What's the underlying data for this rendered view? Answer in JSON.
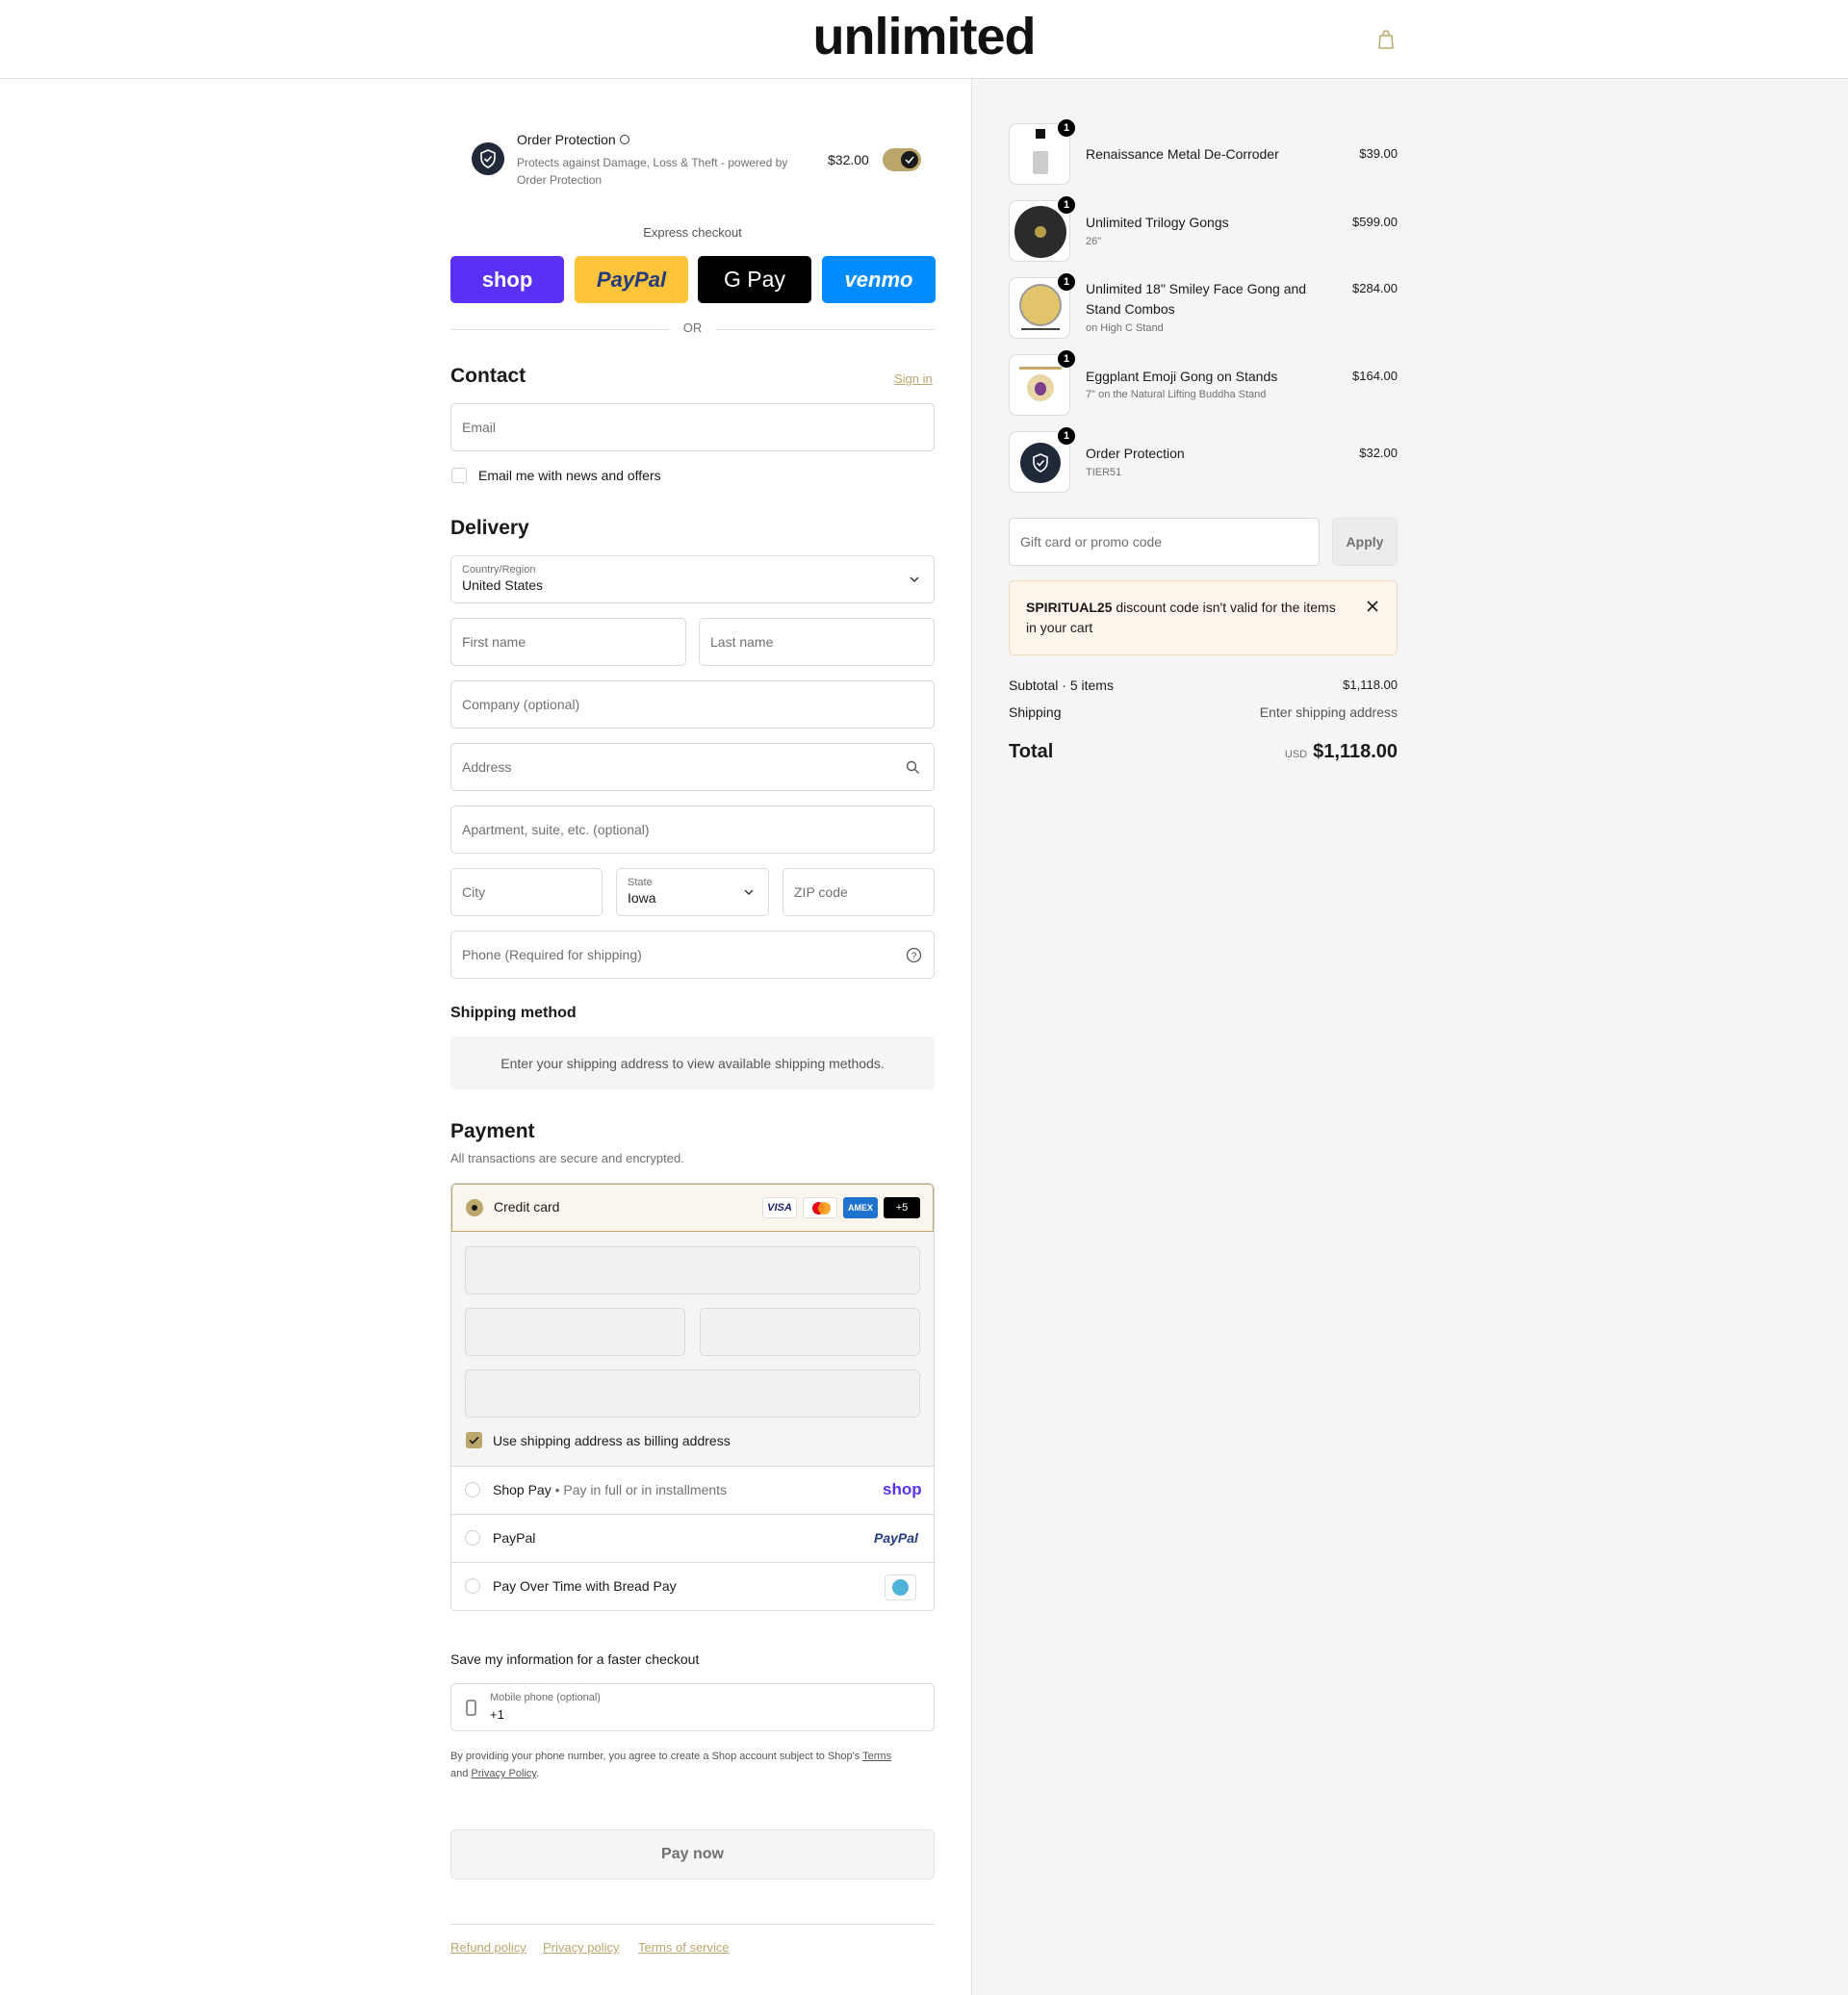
{
  "header": {
    "logo": "unlimited",
    "cart_icon": "bag-icon"
  },
  "order_protection": {
    "title": "Order Protection",
    "description_line1": "Protects against Damage, Loss & Theft - powered by",
    "description_line2": "Order Protection",
    "price": "$32.00",
    "toggle_on": true
  },
  "express": {
    "label": "Express checkout",
    "buttons": [
      "shop",
      "PayPal",
      "G Pay",
      "venmo"
    ],
    "or": "OR"
  },
  "contact": {
    "title": "Contact",
    "sign_in": "Sign in",
    "email_placeholder": "Email",
    "newsletter_label": "Email me with news and offers"
  },
  "delivery": {
    "title": "Delivery",
    "country_label": "Country/Region",
    "country_value": "United States",
    "first_name": "First name",
    "last_name": "Last name",
    "company": "Company (optional)",
    "address": "Address",
    "apartment": "Apartment, suite, etc. (optional)",
    "city": "City",
    "state_label": "State",
    "state_value": "Iowa",
    "zip": "ZIP code",
    "phone": "Phone (Required for shipping)"
  },
  "shipping_method": {
    "title": "Shipping method",
    "message": "Enter your shipping address to view available shipping methods."
  },
  "payment": {
    "title": "Payment",
    "subtitle": "All transactions are secure and encrypted.",
    "credit_card_label": "Credit card",
    "card_logos": [
      "VISA",
      "mastercard",
      "AMEX",
      "+5"
    ],
    "billing_same": "Use shipping address as billing address",
    "shop_pay_label": "Shop Pay",
    "shop_pay_sub": "Pay in full or in installments",
    "shop_pay_logo": "shop",
    "paypal_label": "PayPal",
    "paypal_logo": "PayPal",
    "bread_label": "Pay Over Time with Bread Pay"
  },
  "save_info": {
    "title": "Save my information for a faster checkout",
    "mobile_label": "Mobile phone (optional)",
    "mobile_value": "+1",
    "disclaimer_prefix": "By providing your phone number, you agree to create a Shop account subject to Shop's ",
    "terms": "Terms",
    "and": "and ",
    "privacy": "Privacy Policy",
    "period": "."
  },
  "pay_now": "Pay now",
  "footer_links": [
    "Refund policy",
    "Privacy policy",
    "Terms of service"
  ],
  "cart": {
    "items": [
      {
        "name": "Renaissance Metal De-Corroder",
        "variant": "",
        "price": "$39.00",
        "qty": "1"
      },
      {
        "name": "Unlimited Trilogy Gongs",
        "variant": "26\"",
        "price": "$599.00",
        "qty": "1"
      },
      {
        "name": "Unlimited 18\" Smiley Face Gong and",
        "name2": "Stand Combos",
        "variant": "on High C Stand",
        "price": "$284.00",
        "qty": "1"
      },
      {
        "name": "Eggplant Emoji Gong on Stands",
        "variant": "7\" on the Natural Lifting Buddha Stand",
        "price": "$164.00",
        "qty": "1"
      },
      {
        "name": "Order Protection",
        "variant": "TIER51",
        "price": "$32.00",
        "qty": "1"
      }
    ],
    "promo_placeholder": "Gift card or promo code",
    "apply": "Apply",
    "error_code": "SPIRITUAL25",
    "error_msg": " discount code isn't valid for the items",
    "error_msg2": "in your cart",
    "subtotal_label": "Subtotal · 5 items",
    "subtotal_value": "$1,118.00",
    "shipping_label": "Shipping",
    "shipping_value": "Enter shipping address",
    "total_label": "Total",
    "currency": "USD",
    "total_value": "$1,118.00"
  },
  "colors": {
    "accent": "#bba66b",
    "shop_purple": "#5a31f4",
    "paypal_yellow": "#ffc439",
    "venmo_blue": "#008cff"
  }
}
